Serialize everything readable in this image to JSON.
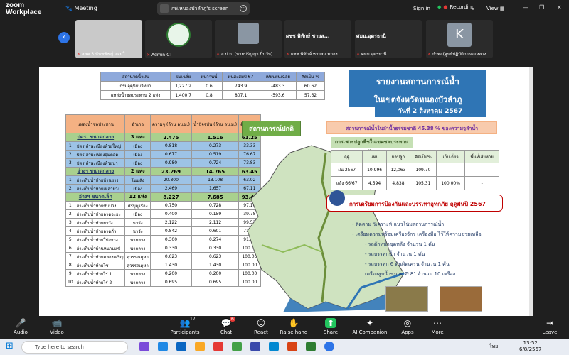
{
  "app": {
    "logo_line1": "zoom",
    "logo_line2": "Workplace",
    "meeting_label": "Meeting",
    "share_title": "กพ.หนองบัวลำภู's screen",
    "sign_in": "Sign in",
    "recording": "Recording",
    "view": "View"
  },
  "participants": [
    {
      "name": "สสค.3 นันทพัชญ์ แจ่มใ"
    },
    {
      "name": "Admin-CT"
    },
    {
      "name": "ส.ป.ก. (นายปรัญญา ปิ่นวัน)"
    },
    {
      "name": "ผชช พิทักษ์ ชายสม มกอง",
      "big": "ผชช พิทักษ์ ชายส..."
    },
    {
      "name": "ศมม.อุดรธานี",
      "big": "ศมม.อุดรธานี"
    },
    {
      "name": "กำพล(ศูนย์ปฏิบัติการผมหลวง",
      "letter": "K"
    }
  ],
  "slide": {
    "top_table": {
      "headers": [
        "สถานีวัดน้ำฝน",
        "ฝนเฉลี่ย",
        "ฝนวานนี้",
        "ฝนสะสมปี 67",
        "เทียบฝนเฉลี่ย",
        "คิดเป็น %"
      ],
      "rows": [
        [
          "กรมอุตุนิยมวิทยา",
          "1,227.2",
          "0.6",
          "743.9",
          "-483.3",
          "60.62"
        ],
        [
          "แหล่งน้ำชลประทาน 2 แห่ง",
          "1,400.7",
          "0.8",
          "807.1",
          "-593.6",
          "57.62"
        ]
      ]
    },
    "main_table": {
      "headers": [
        "แหล่งน้ำชลประทาน",
        "อำเภอ",
        "ความจุ (ล้าน ลบ.ม.)",
        "น้ำปัจจุบัน (ล้าน ลบ.ม.)",
        "คิดเป็น %"
      ],
      "rows": [
        {
          "k": "g",
          "c": [
            "ปตร. ขนาดกลาง",
            "3 แห่ง",
            "2.475",
            "1.516",
            "61.25"
          ]
        },
        {
          "k": "b",
          "c": [
            "1",
            "ปตร.ลำพะเนียงห้วยใหญ่",
            "เมือง",
            "0.818",
            "0.273",
            "33.33"
          ]
        },
        {
          "k": "b",
          "c": [
            "2",
            "ปตร.ลำพะเนียงอุ่มตอด",
            "เมือง",
            "0.677",
            "0.519",
            "76.67"
          ]
        },
        {
          "k": "b",
          "c": [
            "3",
            "ปตร.ลำพะเนียงห้วยนา",
            "เมือง",
            "0.980",
            "0.724",
            "73.83"
          ]
        },
        {
          "k": "g",
          "c": [
            "อ่างฯ ขนาดกลาง",
            "2 แห่ง",
            "23.269",
            "14.765",
            "63.45"
          ]
        },
        {
          "k": "b",
          "c": [
            "1",
            "อ่างเก็บน้ำห้วยบ้านยาง",
            "โนนสัง",
            "20.800",
            "13.108",
            "63.02"
          ]
        },
        {
          "k": "b",
          "c": [
            "2",
            "อ่างเก็บน้ำห้วยเหล่ายาง",
            "เมือง",
            "2.469",
            "1.657",
            "67.11"
          ]
        },
        {
          "k": "g",
          "c": [
            "อ่างฯ ขนาดเล็ก",
            "12 แห่ง",
            "8.227",
            "7.685",
            "93.41"
          ]
        },
        {
          "k": "w",
          "c": [
            "1",
            "อ่างเก็บน้ำห้วยซับม่วง",
            "ศรีบุญเรือง",
            "0.750",
            "0.728",
            "97.10"
          ]
        },
        {
          "k": "w",
          "c": [
            "2",
            "อ่างเก็บน้ำห้วยลาดจะยะ",
            "เมือง",
            "0.400",
            "0.159",
            "39.78"
          ]
        },
        {
          "k": "w",
          "c": [
            "3",
            "อ่างเก็บน้ำห้วยผาวัง",
            "นาวัง",
            "2.122",
            "2.112",
            "99.52"
          ]
        },
        {
          "k": "w",
          "c": [
            "4",
            "อ่างเก็บน้ำห้วยลาดกั่ว",
            "นาวัง",
            "0.842",
            "0.601",
            "71.40"
          ]
        },
        {
          "k": "w",
          "c": [
            "5",
            "อ่างเก็บน้ำห้วยโปงซาง",
            "นากลาง",
            "0.300",
            "0.274",
            "91.30"
          ]
        },
        {
          "k": "w",
          "c": [
            "6",
            "อ่างเก็บน้ำบ้านหนามแช่",
            "นากลาง",
            "0.330",
            "0.330",
            "100.00"
          ]
        },
        {
          "k": "w",
          "c": [
            "7",
            "อ่างเก็บน้ำห้วยคลองเจริญ",
            "สุวรรณคูหา",
            "0.623",
            "0.623",
            "100.00"
          ]
        },
        {
          "k": "w",
          "c": [
            "8",
            "อ่างเก็บน้ำห้วยไซ",
            "สุวรรณคูหา",
            "1.430",
            "1.430",
            "100.00"
          ]
        },
        {
          "k": "w",
          "c": [
            "9",
            "อ่างเก็บน้ำห้วยไร่ 1",
            "นากลาง",
            "0.200",
            "0.200",
            "100.00"
          ]
        },
        {
          "k": "w",
          "c": [
            "10",
            "อ่างเก็บน้ำห้วยไร่ 2",
            "นากลาง",
            "0.695",
            "0.695",
            "100.00"
          ]
        }
      ]
    },
    "title1": "รายงานสถานการณ์น้ำ",
    "title2": "ในเขตจังหวัดหนองบัวลำภู",
    "date": "วันที่ 2 สิงหาคม 2567",
    "situation": "สถานการณ์ปกติ",
    "storage": "สถานการณ์น้ำในลำน้ำธรรมชาติ 45.38 % ของความจุลำน้ำ",
    "farm_title": "การเพาะปลูกพืชในเขตชลประทาน (ไร่)",
    "farm_table": {
      "headers": [
        "ฤดู",
        "แผน",
        "ผลปลูก",
        "คิดเป็น%",
        "เก็บเกี่ยว",
        "พื้นที่เสียหาย"
      ],
      "rows": [
        [
          "ฝน 2567",
          "10,996",
          "12,063",
          "109.70",
          "-",
          "-"
        ],
        [
          "แล้ง 66/67",
          "4,594",
          "4,838",
          "105.31",
          "100.00%",
          "-"
        ]
      ]
    },
    "prep_title": "การเตรียมการป้องกันและบรรเทาอุทกภัย ฤดูฝนปี 2567",
    "prep_lines": [
      "- ติดตาม วิเคราะห์ แนวโน้มสถานการณ์น้ำ",
      "- เตรียมความพร้อมเครื่องจักร เครื่องมือ ไว้ให้ความช่วยเหลือ",
      "- รถตักหน้าขุดหลัง      จำนวน  1 คัน",
      "- รถบรรทุกน้ำ            จำนวน  1 คัน",
      "- รถบรรทุก 6 ตันติดเครน  จำนวน  1 คัน",
      "เครื่องสูบน้ำขนาด Ø 8\"   จำนวน 10 เครื่อง"
    ]
  },
  "toolbar": [
    {
      "label": "Audio",
      "icon": "mic-icon"
    },
    {
      "label": "Video",
      "icon": "camera-icon"
    },
    {
      "label": "Participants",
      "icon": "people-icon",
      "count": "17"
    },
    {
      "label": "Chat",
      "icon": "chat-icon",
      "count": "6"
    },
    {
      "label": "React",
      "icon": "smile-icon"
    },
    {
      "label": "Raise hand",
      "icon": "hand-icon"
    },
    {
      "label": "Share",
      "icon": "share-icon"
    },
    {
      "label": "AI Companion",
      "icon": "sparkle-icon"
    },
    {
      "label": "Apps",
      "icon": "apps-icon"
    },
    {
      "label": "More",
      "icon": "more-icon"
    },
    {
      "label": "Leave",
      "icon": "leave-icon"
    }
  ],
  "taskbar": {
    "search": "Type here to search",
    "time": "13:52",
    "date": "6/8/2567",
    "lang": "ไทย"
  },
  "colors": {
    "accent": "#2d74e7",
    "rec": "#e53935",
    "share": "#22c55e"
  }
}
